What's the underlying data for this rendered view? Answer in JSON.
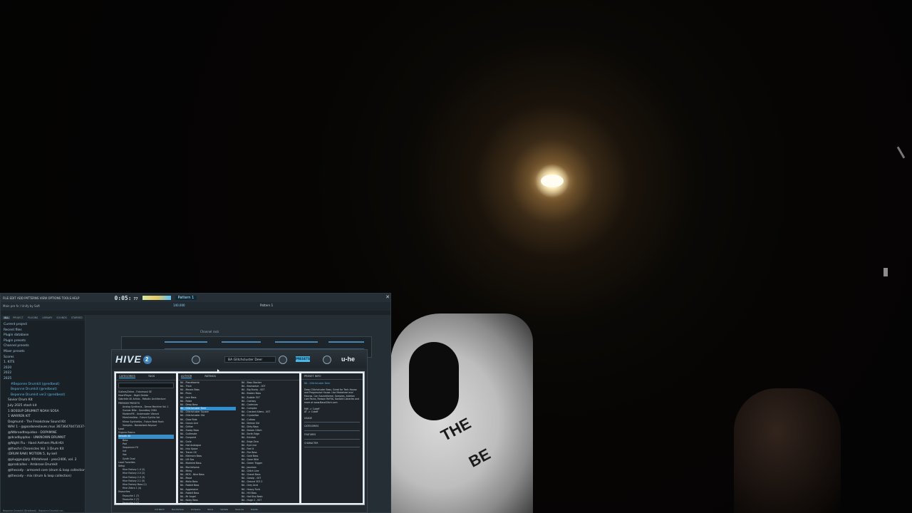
{
  "fl": {
    "menu": "FILE EDIT ADD PATTERNS VIEW OPTIONS TOOLS HELP",
    "time": "0:05:",
    "time_frac": "77",
    "pattern": "Pattern 1",
    "hint": "Main pre fx / Unify by Soft",
    "tempo": "140.000",
    "pattern_label": "Pattern 1",
    "close": "✕"
  },
  "browser": {
    "tabs": [
      "ALL",
      "PROJECT",
      "PLUGINS",
      "LIBRARY",
      "SOUNDS",
      "STARRED"
    ],
    "items": [
      {
        "label": "Current project",
        "cls": "folder"
      },
      {
        "label": "Recent files",
        "cls": "folder"
      },
      {
        "label": "Plugin database",
        "cls": "folder"
      },
      {
        "label": "Plugin presets",
        "cls": "folder"
      },
      {
        "label": "Channel presets",
        "cls": "folder"
      },
      {
        "label": "Mixer presets",
        "cls": "folder"
      },
      {
        "label": "Scores",
        "cls": "folder"
      },
      {
        "label": "1. KITS",
        "cls": "folder"
      },
      {
        "label": "2020",
        "cls": "folder"
      },
      {
        "label": "2022",
        "cls": "folder"
      },
      {
        "label": "2025",
        "cls": "folder"
      },
      {
        "label": "#Beponne Drumkit (@redbeat)",
        "cls": "sub2"
      },
      {
        "label": "Beponne Drumkit (@redbeat)",
        "cls": "sub2"
      },
      {
        "label": "Beponne Drumkit ver2 (@redbeat)",
        "cls": "sub2"
      },
      {
        "label": "Savior Drum Kit",
        "cls": "sub"
      },
      {
        "label": "July 2025 stash kit",
        "cls": "sub"
      },
      {
        "label": "1 BOSSUP DRUMKIT NOAH SOSA",
        "cls": "sub"
      },
      {
        "label": "1 WARREN KIT",
        "cls": "sub"
      },
      {
        "label": "Dogmund - The Freakshow Sound Kit",
        "cls": "sub"
      },
      {
        "label": "WAV 1 - @goodoneslaves.mus 36736470471037-09",
        "cls": "sub"
      },
      {
        "label": "@Ntbroodtsquidoo - DOPAMINE",
        "cls": "sub"
      },
      {
        "label": "@dcodbyqdoo - UNKNOWN DRUMKIT",
        "cls": "sub"
      },
      {
        "label": "@Night Flu - Hand Anthem Multi-Kit",
        "cls": "sub"
      },
      {
        "label": "@thechri Chronicles Vol. 3 Drum Kit",
        "cls": "sub"
      },
      {
        "label": "(DRUM RAW) MOTION 5, by kell",
        "cls": "sub"
      },
      {
        "label": "@pluggsupply 40tdahead - year2406, vol. 2",
        "cls": "sub"
      },
      {
        "label": "@prodcalles - Ambrose Drumkit",
        "cls": "sub"
      },
      {
        "label": "@thecody - armored core (drum & loop collection)",
        "cls": "sub"
      },
      {
        "label": "@thecody - mix (drum & loop collection)",
        "cls": "sub"
      }
    ],
    "status": "Beponne Drumkit (@redbeat) - Beponne Drumkit ver..."
  },
  "channel_rack": {
    "title": "Channel rack"
  },
  "hive": {
    "logo": "HIVE",
    "logo_num": "2",
    "preset_name": "BA   Glitchcluster Deer",
    "presets_button": "PRESETS",
    "brand": "u-he",
    "tabs": [
      "CATEGORIES",
      "TAGS"
    ],
    "list_tabs": [
      "AUTHOR",
      "RATINGS"
    ],
    "info_title": "PRESET INFO",
    "categories": [
      {
        "label": "Guitars/Zebra - Futuresoul SE",
        "cls": ""
      },
      {
        "label": "HeartPlayer - Night Delete",
        "cls": ""
      },
      {
        "label": "Gabrielle All Artists - Melodic Architecture",
        "cls": ""
      },
      {
        "label": "PREMIUM PRESETS",
        "cls": ""
      },
      {
        "label": "Analog Synthesis - Dense Machine Vol. 1",
        "cls": "ind"
      },
      {
        "label": "Gunnar Blitz - Soundboy 2084",
        "cls": "ind"
      },
      {
        "label": "ModernFM - Underwater Vibrant",
        "cls": "ind"
      },
      {
        "label": "Marshmellow - Future Synths Vol.",
        "cls": "ind"
      },
      {
        "label": "Mirror Synthetics - Future Beat Rush",
        "cls": "ind"
      },
      {
        "label": "Samples - Bandalised Abyssal",
        "cls": "ind"
      },
      {
        "label": "Local",
        "cls": ""
      },
      {
        "label": "Organic Basics",
        "cls": ""
      },
      {
        "label": "Smooth All",
        "cls": "sel"
      },
      {
        "label": "Bass",
        "cls": "ind"
      },
      {
        "label": "Pad",
        "cls": "ind"
      },
      {
        "label": "Sequencer FX",
        "cls": "ind"
      },
      {
        "label": "Init",
        "cls": "ind"
      },
      {
        "label": "Vox",
        "cls": "ind"
      },
      {
        "label": "Synth Dual",
        "cls": "ind"
      },
      {
        "label": "Local Favorites",
        "cls": ""
      },
      {
        "label": "Setup",
        "cls": ""
      },
      {
        "label": "Hive Factory 1.0 (2)",
        "cls": "ind"
      },
      {
        "label": "Hive Factory 2.0 (2)",
        "cls": "ind"
      },
      {
        "label": "Hive Factory 2.0 (3)",
        "cls": "ind"
      },
      {
        "label": "Hive Factory 2.1 (5)",
        "cls": "ind"
      },
      {
        "label": "Hive Factory Bass (1)",
        "cls": "ind"
      },
      {
        "label": "Hive Zebra 1 (4)",
        "cls": "ind"
      },
      {
        "label": "Favourites",
        "cls": ""
      },
      {
        "label": "Favourite 1 (7)",
        "cls": "ind"
      },
      {
        "label": "Favourite 2 (7)",
        "cls": "ind"
      },
      {
        "label": "Favourite 3 (7)",
        "cls": "ind"
      },
      {
        "label": "Favourite 4 (7)",
        "cls": "ind"
      },
      {
        "label": "Favourite 5 (7)",
        "cls": "ind"
      }
    ],
    "presets": [
      {
        "label": "BA - Planetbomb",
        "cls": ""
      },
      {
        "label": "BA - Thick",
        "cls": ""
      },
      {
        "label": "BA - Mosaic Bass",
        "cls": ""
      },
      {
        "label": "BA - Pluto",
        "cls": ""
      },
      {
        "label": "BA - Jack Bass",
        "cls": ""
      },
      {
        "label": "BA - Raise",
        "cls": ""
      },
      {
        "label": "BA - Deep Bass",
        "cls": ""
      },
      {
        "label": "BA - Glitchcluster Deer",
        "cls": "sel"
      },
      {
        "label": "BA - Glitchcluster Square",
        "cls": ""
      },
      {
        "label": "BA - Glitchcluster Old",
        "cls": ""
      },
      {
        "label": "BA - Glow Ride",
        "cls": ""
      },
      {
        "label": "BA - Gonzo Line",
        "cls": ""
      },
      {
        "label": "BA - Gritter",
        "cls": ""
      },
      {
        "label": "BA - Zooby Bass",
        "cls": ""
      },
      {
        "label": "BA - Gultimate",
        "cls": ""
      },
      {
        "label": "BA - Gunpoint",
        "cls": ""
      },
      {
        "label": "BA - Guile",
        "cls": ""
      },
      {
        "label": "BA - Hot Analogue",
        "cls": ""
      },
      {
        "label": "BA - Into Space",
        "cls": ""
      },
      {
        "label": "BA - Tracer GS",
        "cls": ""
      },
      {
        "label": "BA - Kikimora Bass",
        "cls": ""
      },
      {
        "label": "BA - Lift Sox",
        "cls": ""
      },
      {
        "label": "BA - Modeled Bass",
        "cls": ""
      },
      {
        "label": "BA - Mortlehome",
        "cls": ""
      },
      {
        "label": "BA - Mirby",
        "cls": ""
      },
      {
        "label": "BA - MDS - Nine Bass",
        "cls": ""
      },
      {
        "label": "BA - Mood",
        "cls": ""
      },
      {
        "label": "BA - Mollo Bass",
        "cls": ""
      },
      {
        "label": "BA - Rabbit Bass",
        "cls": ""
      },
      {
        "label": "BA - Aggressive",
        "cls": ""
      },
      {
        "label": "BA - Rabbit Bass",
        "cls": ""
      },
      {
        "label": "BA - Mr Angel",
        "cls": ""
      },
      {
        "label": "BA - Noisy Bass",
        "cls": ""
      },
      {
        "label": "BA - Rig Biggy",
        "cls": ""
      },
      {
        "label": "BA - Spring Bass",
        "cls": ""
      },
      {
        "label": "BA - Audit Bass",
        "cls": ""
      },
      {
        "label": "BA - Andrew Thorne",
        "cls": ""
      },
      {
        "label": "BA - Keiko Hentai - 007",
        "cls": ""
      },
      {
        "label": "BA - Bass Stacker",
        "cls": ""
      },
      {
        "label": "BA - Brainwave - 007",
        "cls": ""
      },
      {
        "label": "BA - Big Bucky - 007",
        "cls": ""
      },
      {
        "label": "BA - Broken Bass",
        "cls": ""
      },
      {
        "label": "BA - Bubble 307",
        "cls": ""
      },
      {
        "label": "BA - Cactasy",
        "cls": ""
      },
      {
        "label": "BA - Cadmium",
        "cls": ""
      },
      {
        "label": "BA - Complex",
        "cls": ""
      },
      {
        "label": "BA - Cracked Aliens - 007",
        "cls": ""
      },
      {
        "label": "BA - Crystallize",
        "cls": ""
      },
      {
        "label": "BA - Cutlass",
        "cls": ""
      },
      {
        "label": "BA - Demon Sid",
        "cls": ""
      },
      {
        "label": "BA - Dirty Bass",
        "cls": ""
      },
      {
        "label": "BA - Dream Glitch",
        "cls": ""
      },
      {
        "label": "BA - Earth Edge",
        "cls": ""
      },
      {
        "label": "BA - Echelon",
        "cls": ""
      },
      {
        "label": "BA - Edge Zero",
        "cls": ""
      },
      {
        "label": "BA - Eye Line",
        "cls": ""
      },
      {
        "label": "BA - Feel It",
        "cls": ""
      },
      {
        "label": "BA - Fire Bass",
        "cls": ""
      },
      {
        "label": "BA - Gold Bass",
        "cls": ""
      },
      {
        "label": "BA - Gone Wild",
        "cls": ""
      },
      {
        "label": "BA - Green Trigger",
        "cls": ""
      },
      {
        "label": "BA - Jazzman",
        "cls": ""
      },
      {
        "label": "BA - Glitch Line",
        "cls": ""
      },
      {
        "label": "BA - Gravel Bass",
        "cls": ""
      },
      {
        "label": "BA - Gossip - 007",
        "cls": ""
      },
      {
        "label": "BA - Ground 303 2",
        "cls": ""
      },
      {
        "label": "BA - Grey Acid",
        "cls": ""
      },
      {
        "label": "BA - Heavy Funk",
        "cls": ""
      },
      {
        "label": "BA - Hill Bass",
        "cls": ""
      },
      {
        "label": "BA - Hot Kiss Basic",
        "cls": ""
      },
      {
        "label": "BA - Huge 2 - 007",
        "cls": ""
      },
      {
        "label": "BA - Insects Bass",
        "cls": ""
      },
      {
        "label": "BA - Jack Me",
        "cls": ""
      },
      {
        "label": "BA - Physics - 007",
        "cls": ""
      },
      {
        "label": "BA - PM Mona 3",
        "cls": ""
      }
    ],
    "info": {
      "name": "BA - Glitchcluster Deer",
      "desc": "Deep Glitchcluster Bass. Great for Tech-House and Progressive House. Use Modwheel and Macros. Can Soundtheme, Samples, Ableton Live Packs, Reason ReFills, Kontakt Libraries and more at www.BassGlitch.com",
      "mw": "MW -> Cutoff",
      "at": "AT -> Cutoff",
      "labels": [
        "USAGE",
        "CATEGORIES",
        "FEATURES",
        "CHARACTER"
      ]
    },
    "footer": [
      "Init Patch",
      "Randomize",
      "Compare",
      "Store",
      "Update",
      "Save As",
      "Delete"
    ]
  }
}
